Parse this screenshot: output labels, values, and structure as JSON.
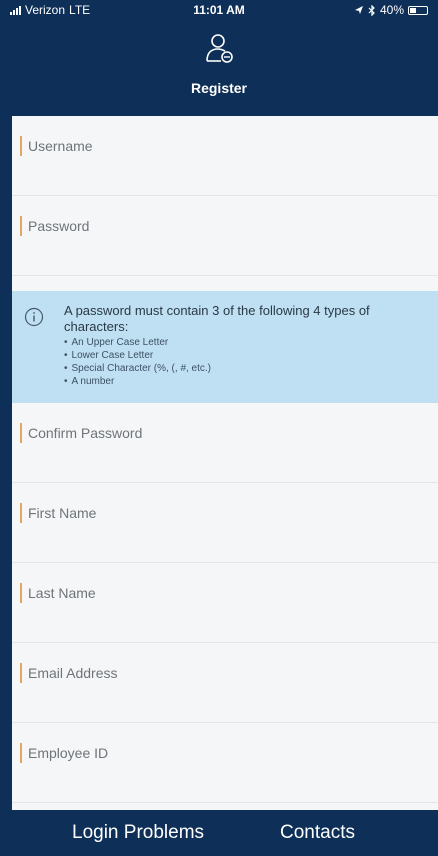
{
  "status_bar": {
    "carrier": "Verizon",
    "network": "LTE",
    "time": "11:01 AM",
    "battery": "40%",
    "battery_level": 0.4
  },
  "header": {
    "title": "Register",
    "icon": "register-user-icon"
  },
  "form": {
    "fields": [
      {
        "label": "Username"
      },
      {
        "label": "Password"
      },
      {
        "label": "Confirm Password"
      },
      {
        "label": "First Name"
      },
      {
        "label": "Last Name"
      },
      {
        "label": "Email Address"
      },
      {
        "label": "Employee ID"
      }
    ],
    "password_info": {
      "icon": "info-icon",
      "text": "A password must contain 3 of the following 4 types of characters:",
      "items": [
        "An Upper Case Letter",
        "Lower Case Letter",
        "Special Character (%, (, #, etc.)",
        "A number"
      ]
    }
  },
  "footer": {
    "login_problems": "Login Problems",
    "contacts": "Contacts"
  },
  "colors": {
    "header_bg": "#0e2f57",
    "form_bg": "#f5f6f7",
    "info_bg": "#bfe0f2",
    "accent": "#e5a65f"
  }
}
